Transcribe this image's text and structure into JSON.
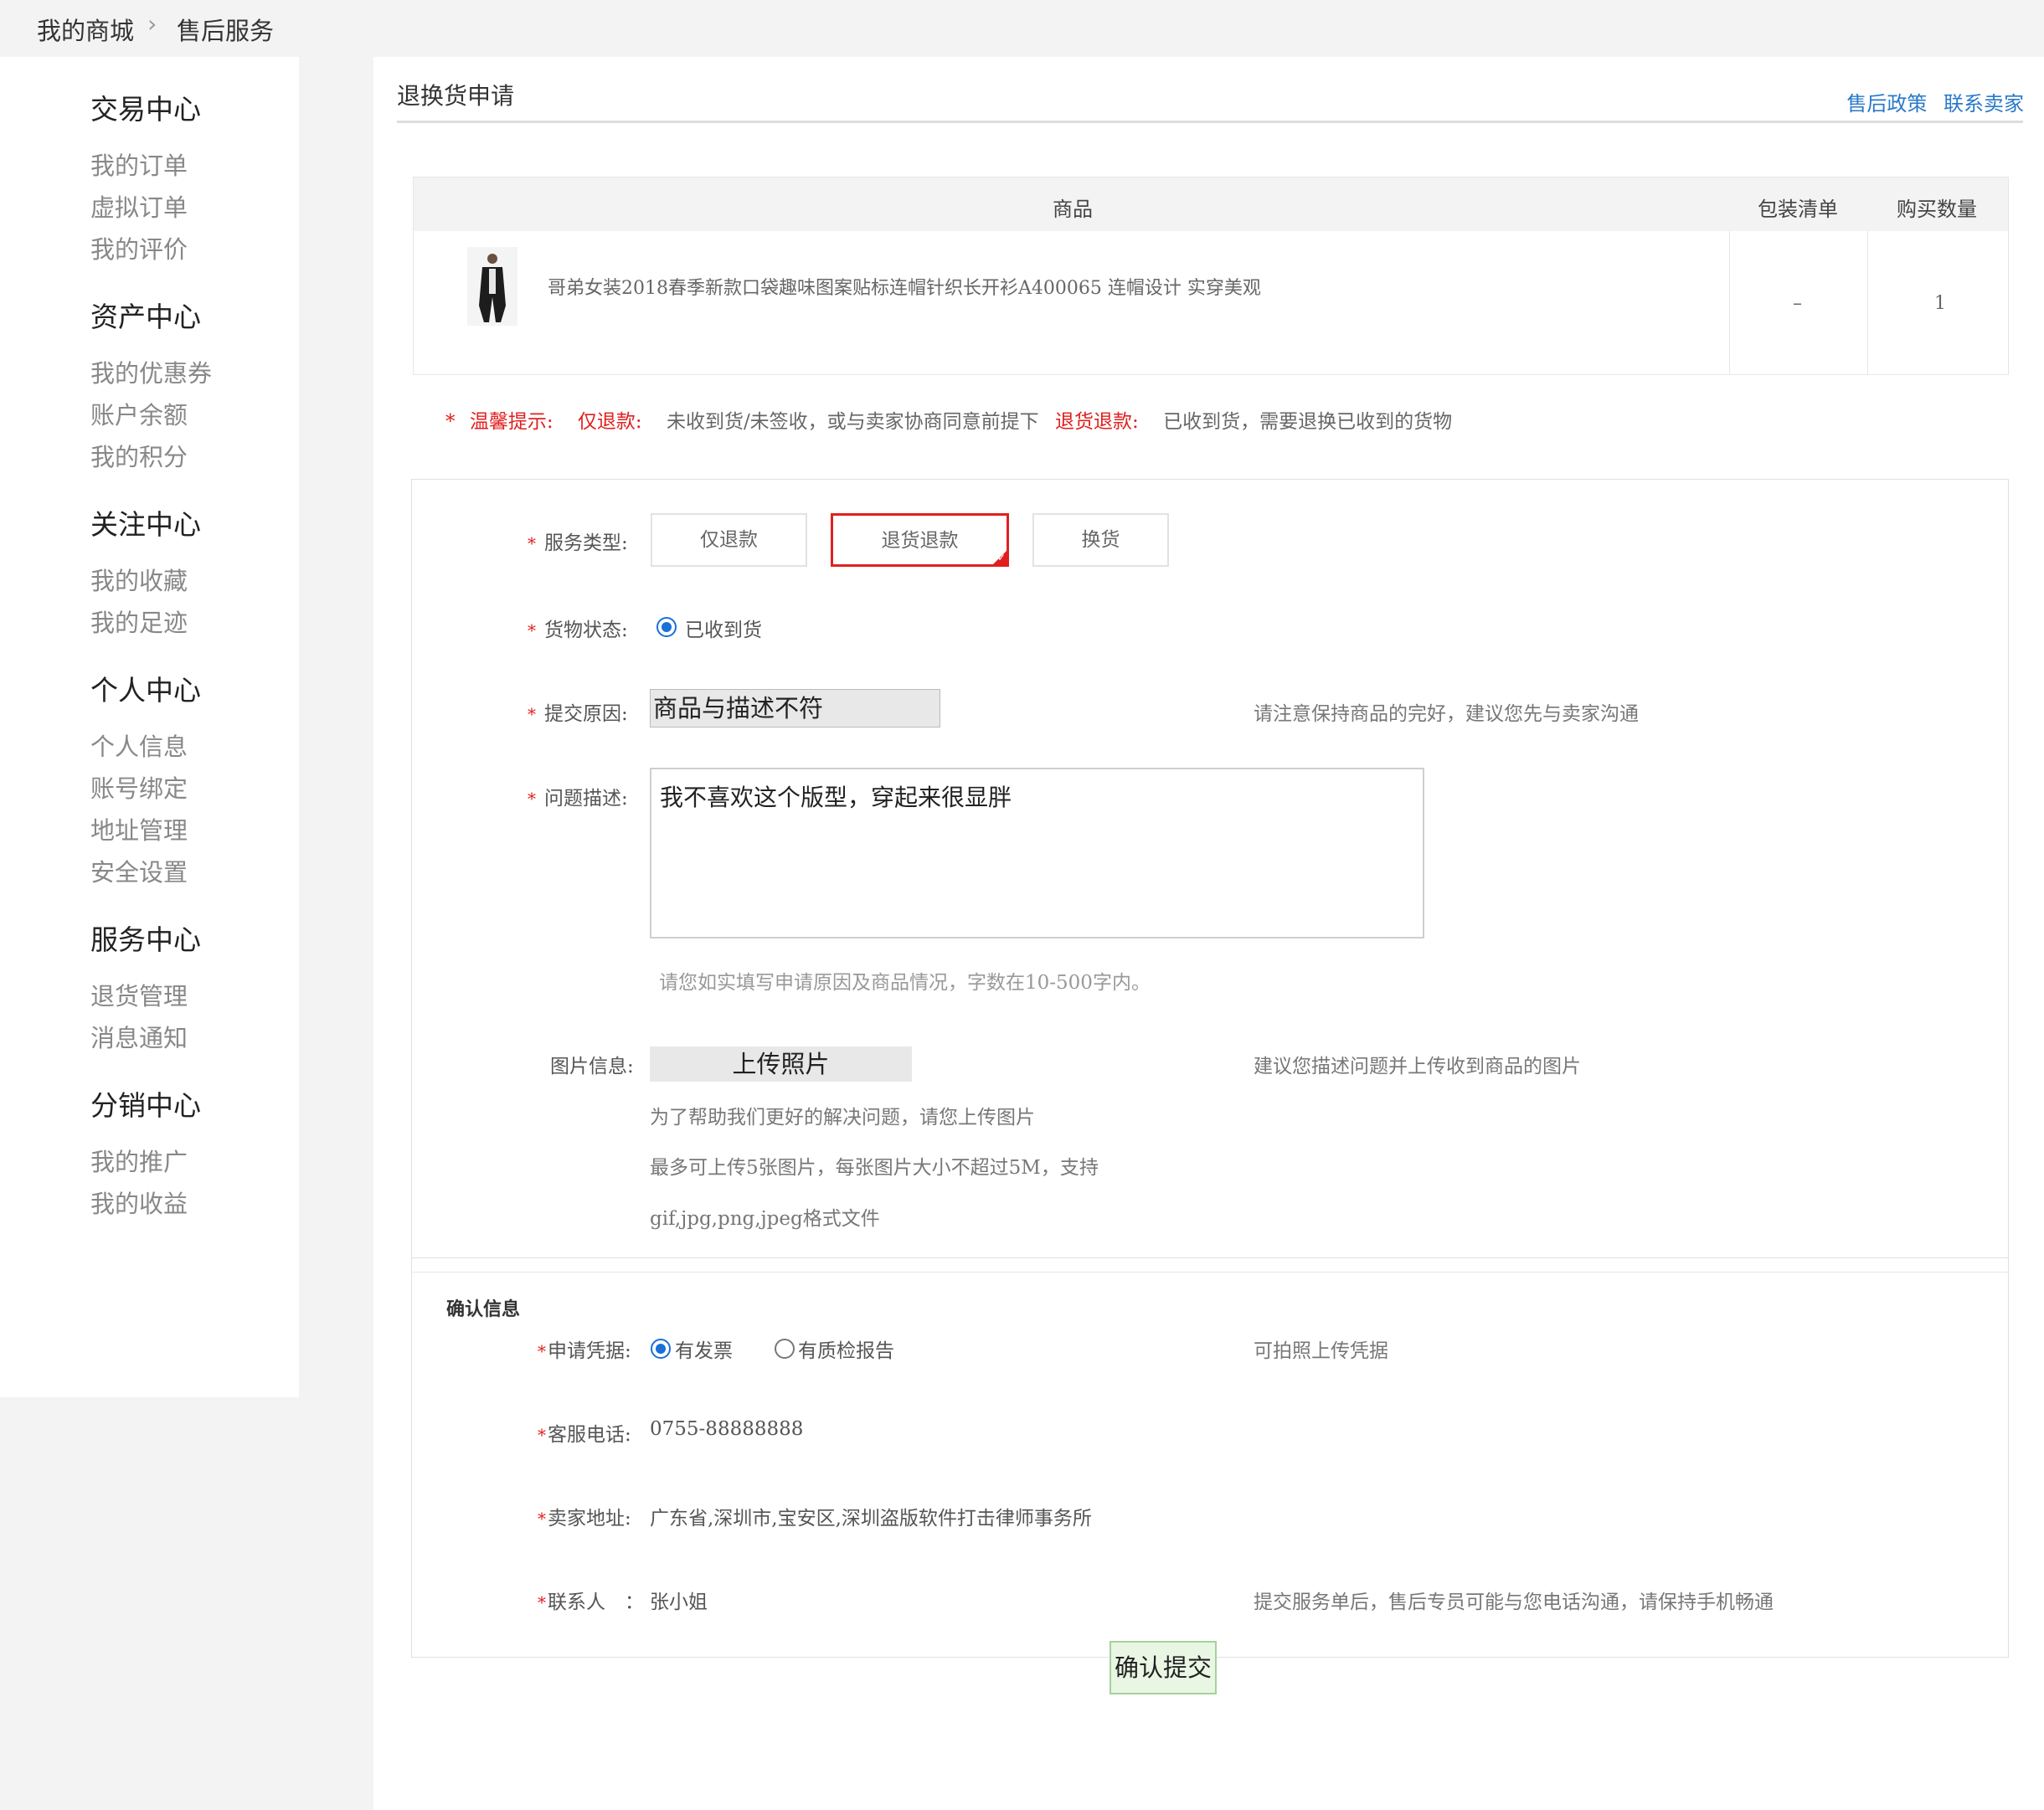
{
  "breadcrumb": {
    "home": "我的商城",
    "current": "售后服务"
  },
  "sidebar": {
    "groups": [
      {
        "title": "交易中心",
        "items": [
          "我的订单",
          "虚拟订单",
          "我的评价"
        ]
      },
      {
        "title": "资产中心",
        "items": [
          "我的优惠券",
          "账户余额",
          "我的积分"
        ]
      },
      {
        "title": "关注中心",
        "items": [
          "我的收藏",
          "我的足迹"
        ]
      },
      {
        "title": "个人中心",
        "items": [
          "个人信息",
          "账号绑定",
          "地址管理",
          "安全设置"
        ]
      },
      {
        "title": "服务中心",
        "items": [
          "退货管理",
          "消息通知"
        ]
      },
      {
        "title": "分销中心",
        "items": [
          "我的推广",
          "我的收益"
        ]
      }
    ]
  },
  "page": {
    "title": "退换货申请",
    "links": [
      "售后政策",
      "联系卖家"
    ]
  },
  "goods_table": {
    "headers": [
      "商品",
      "包装清单",
      "购买数量"
    ],
    "row": {
      "name": "哥弟女装2018春季新款口袋趣味图案贴标连帽针织长开衫A400065 连帽设计 实穿美观",
      "package": "–",
      "qty": "1"
    }
  },
  "tip": {
    "star": "*",
    "label": "温馨提示:",
    "refund_only": "仅退款:",
    "refund_only_desc": "未收到货/未签收，或与卖家协商同意前提下",
    "return_refund": "退货退款:",
    "return_refund_desc": "已收到货，需要退换已收到的货物"
  },
  "form": {
    "service_type_label": "服务类型:",
    "service_types": [
      "仅退款",
      "退货退款",
      "换货"
    ],
    "service_type_selected": "退货退款",
    "goods_status_label": "货物状态:",
    "goods_status_value": "已收到货",
    "reason_label": "提交原因:",
    "reason_value": "商品与描述不符",
    "reason_note": "请注意保持商品的完好，建议您先与卖家沟通",
    "desc_label": "问题描述:",
    "desc_value": "我不喜欢这个版型，穿起来很显胖",
    "desc_hint": "请您如实填写申请原因及商品情况，字数在10-500字内。",
    "image_label": "图片信息:",
    "upload_label": "上传照片",
    "image_note": "建议您描述问题并上传收到商品的图片",
    "image_help_1": "为了帮助我们更好的解决问题，请您上传图片",
    "image_help_2": "最多可上传5张图片，每张图片大小不超过5M，支持",
    "image_help_3": "gif,jpg,png,jpeg格式文件"
  },
  "confirm": {
    "section_title": "确认信息",
    "proof_label": "申请凭据:",
    "proof_options": [
      "有发票",
      "有质检报告"
    ],
    "proof_selected": "有发票",
    "proof_note": "可拍照上传凭据",
    "phone_label": "客服电话:",
    "phone_value": "0755-88888888",
    "address_label": "卖家地址:",
    "address_value": "广东省,深圳市,宝安区,深圳盗版软件打击律师事务所",
    "contact_label": "联系人　：",
    "contact_value": "张小姐",
    "contact_note": "提交服务单后，售后专员可能与您电话沟通，请保持手机畅通"
  },
  "submit_label": "确认提交",
  "colors": {
    "accent_red": "#e02020",
    "link_blue": "#2979c9",
    "radio_blue": "#1a6fd9",
    "submit_bg": "#e9f6e4"
  }
}
